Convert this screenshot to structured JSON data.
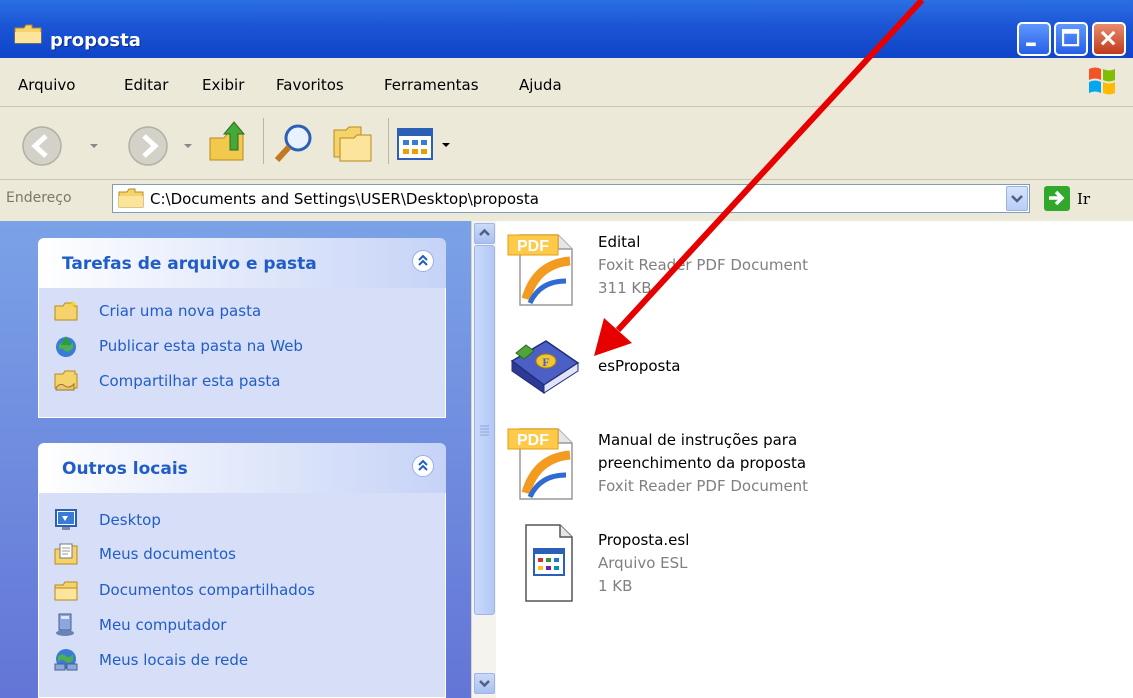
{
  "window": {
    "title": "proposta"
  },
  "menu": {
    "items": [
      {
        "label": "Arquivo"
      },
      {
        "label": "Editar"
      },
      {
        "label": "Exibir"
      },
      {
        "label": "Favoritos"
      },
      {
        "label": "Ferramentas"
      },
      {
        "label": "Ajuda"
      }
    ]
  },
  "address": {
    "label": "Endereço",
    "path": "C:\\Documents and Settings\\USER\\Desktop\\proposta",
    "go_label": "Ir"
  },
  "tasks_panel": {
    "title": "Tarefas de arquivo e pasta",
    "items": [
      {
        "label": "Criar uma nova pasta",
        "icon": "new-folder-icon"
      },
      {
        "label": "Publicar esta pasta na Web",
        "icon": "publish-web-icon"
      },
      {
        "label": "Compartilhar esta pasta",
        "icon": "share-folder-icon"
      }
    ]
  },
  "places_panel": {
    "title": "Outros locais",
    "items": [
      {
        "label": "Desktop",
        "icon": "desktop-icon"
      },
      {
        "label": "Meus documentos",
        "icon": "my-documents-icon"
      },
      {
        "label": "Documentos compartilhados",
        "icon": "shared-documents-icon"
      },
      {
        "label": "Meu computador",
        "icon": "my-computer-icon"
      },
      {
        "label": "Meus locais de rede",
        "icon": "network-places-icon"
      }
    ]
  },
  "files": [
    {
      "name": "Edital",
      "type": "Foxit Reader PDF Document",
      "size": "311 KB",
      "icon": "pdf-icon",
      "pdf_label": "PDF"
    },
    {
      "name": "esProposta",
      "icon": "application-book-icon"
    },
    {
      "name_line1": "Manual de instruções para",
      "name_line2": "preenchimento da proposta",
      "type": "Foxit Reader PDF Document",
      "icon": "pdf-icon",
      "pdf_label": "PDF"
    },
    {
      "name": "Proposta.esl",
      "type": "Arquivo ESL",
      "size": "1 KB",
      "icon": "esl-file-icon"
    }
  ],
  "colors": {
    "title_bar": "#1B55D6",
    "task_pane": "#6375D6",
    "panel_title": "#215DC6",
    "annotation_arrow": "#E60000"
  }
}
